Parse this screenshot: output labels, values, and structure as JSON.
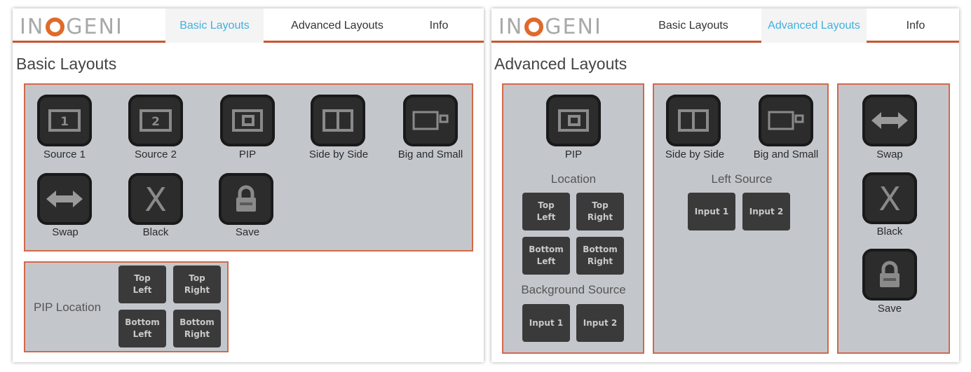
{
  "left": {
    "logo": "INOGENI",
    "tabs": [
      "Basic Layouts",
      "Advanced Layouts",
      "Info"
    ],
    "active_tab": "Basic Layouts",
    "title": "Basic Layouts",
    "tiles": [
      {
        "icon": "source-1-icon",
        "glyph": "1",
        "label": "Source 1"
      },
      {
        "icon": "source-2-icon",
        "glyph": "2",
        "label": "Source 2"
      },
      {
        "icon": "pip-icon",
        "label": "PIP"
      },
      {
        "icon": "side-by-side-icon",
        "label": "Side by Side"
      },
      {
        "icon": "big-and-small-icon",
        "label": "Big and Small"
      },
      {
        "icon": "swap-icon",
        "label": "Swap"
      },
      {
        "icon": "black-icon",
        "glyph": "X",
        "label": "Black"
      },
      {
        "icon": "lock-icon",
        "label": "Save"
      }
    ],
    "pip_location": {
      "label": "PIP Location",
      "buttons": [
        "Top\nLeft",
        "Top\nRight",
        "Bottom\nLeft",
        "Bottom\nRight"
      ]
    }
  },
  "right": {
    "logo": "INOGENI",
    "tabs": [
      "Basic Layouts",
      "Advanced Layouts",
      "Info"
    ],
    "active_tab": "Advanced Layouts",
    "title": "Advanced Layouts",
    "pip_box": {
      "tile_label": "PIP",
      "location_label": "Location",
      "location_buttons": [
        "Top\nLeft",
        "Top\nRight",
        "Bottom\nLeft",
        "Bottom\nRight"
      ],
      "background_label": "Background Source",
      "background_buttons": [
        "Input 1",
        "Input 2"
      ]
    },
    "split_box": {
      "tiles": [
        "Side by Side",
        "Big and Small"
      ],
      "left_source_label": "Left Source",
      "left_source_buttons": [
        "Input 1",
        "Input 2"
      ]
    },
    "action_box": {
      "tiles": [
        "Swap",
        "Black",
        "Save"
      ]
    }
  },
  "colors": {
    "accent": "#c8572f",
    "active_tab": "#3fb0df",
    "box_bg": "#c3c7cc",
    "box_border": "#d2694a",
    "tile_bg": "#2c2c2c"
  }
}
